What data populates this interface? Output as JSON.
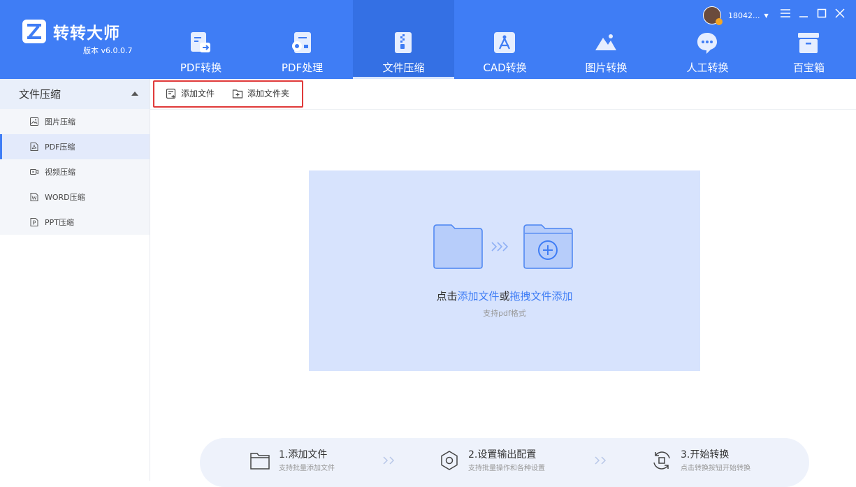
{
  "app": {
    "title": "转转大师",
    "version": "版本 v6.0.0.7"
  },
  "user": {
    "name": "18042..."
  },
  "nav": {
    "items": [
      {
        "label": "PDF转换",
        "icon": "pdf-convert-icon"
      },
      {
        "label": "PDF处理",
        "icon": "pdf-process-icon"
      },
      {
        "label": "文件压缩",
        "icon": "file-compress-icon",
        "active": true
      },
      {
        "label": "CAD转换",
        "icon": "cad-convert-icon"
      },
      {
        "label": "图片转换",
        "icon": "image-convert-icon"
      },
      {
        "label": "人工转换",
        "icon": "manual-convert-icon"
      },
      {
        "label": "百宝箱",
        "icon": "toolbox-icon"
      }
    ]
  },
  "sidebar": {
    "header": "文件压缩",
    "items": [
      {
        "label": "图片压缩",
        "icon": "image-icon"
      },
      {
        "label": "PDF压缩",
        "icon": "pdf-icon",
        "active": true
      },
      {
        "label": "视频压缩",
        "icon": "video-icon"
      },
      {
        "label": "WORD压缩",
        "icon": "word-icon"
      },
      {
        "label": "PPT压缩",
        "icon": "ppt-icon"
      }
    ]
  },
  "toolbar": {
    "add_file": "添加文件",
    "add_folder": "添加文件夹"
  },
  "dropzone": {
    "prefix": "点击",
    "link1": "添加文件",
    "middle": "或",
    "link2": "拖拽文件添加",
    "hint": "支持pdf格式"
  },
  "steps": [
    {
      "title": "1.添加文件",
      "desc": "支持批量添加文件"
    },
    {
      "title": "2.设置输出配置",
      "desc": "支持批量操作和各种设置"
    },
    {
      "title": "3.开始转换",
      "desc": "点击转换按钮开始转换"
    }
  ],
  "colors": {
    "brand": "#3f7df5",
    "header_active": "#3470e4",
    "dropzone_bg": "#d7e3fd",
    "highlight_border": "#e03a3a"
  }
}
